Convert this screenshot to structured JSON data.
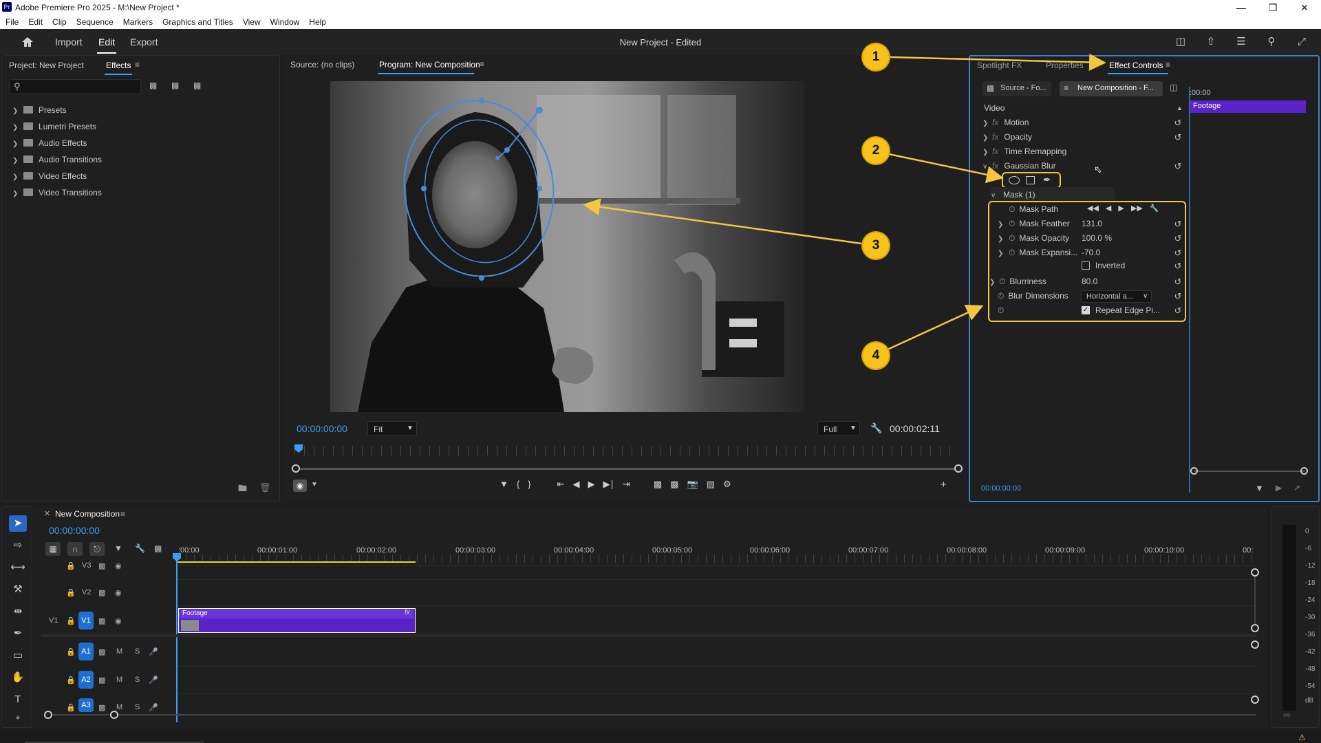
{
  "window": {
    "title": "Adobe Premiere Pro 2025 - M:\\New Project *",
    "logo_text": "Pr"
  },
  "menu": [
    "File",
    "Edit",
    "Clip",
    "Sequence",
    "Markers",
    "Graphics and Titles",
    "View",
    "Window",
    "Help"
  ],
  "header": {
    "nav": [
      "Import",
      "Edit",
      "Export"
    ],
    "active_nav": "Edit",
    "project_title": "New Project",
    "project_status": "- Edited"
  },
  "effects_panel": {
    "tab_project": "Project: New Project",
    "tab_effects": "Effects",
    "search_placeholder": "",
    "folders": [
      "Presets",
      "Lumetri Presets",
      "Audio Effects",
      "Audio Transitions",
      "Video Effects",
      "Video Transitions"
    ]
  },
  "monitor": {
    "tab_source": "Source: (no clips)",
    "tab_program": "Program: New Composition",
    "timecode_current": "00:00:00:00",
    "zoom": "Fit",
    "quality": "Full",
    "timecode_duration": "00:00:02:11"
  },
  "effect_controls": {
    "tab_spotlight": "Spotlight FX",
    "tab_properties": "Properties",
    "tab_effect_controls": "Effect Controls",
    "source_btn": "Source - Fo...",
    "comp_btn": "New Composition - F...",
    "mini_timecode": ":00:00",
    "clip_name": "Footage",
    "section_video": "Video",
    "effects": [
      "Motion",
      "Opacity",
      "Time Remapping",
      "Gaussian Blur"
    ],
    "mask_label": "Mask (1)",
    "mask_path": "Mask Path",
    "props": [
      {
        "label": "Mask Feather",
        "value": "131.0"
      },
      {
        "label": "Mask Opacity",
        "value": "100.0 %"
      },
      {
        "label": "Mask Expansi...",
        "value": "-70.0"
      }
    ],
    "inverted_label": "Inverted",
    "inverted_checked": false,
    "blurriness_label": "Blurriness",
    "blurriness_value": "80.0",
    "blur_dim_label": "Blur Dimensions",
    "blur_dim_value": "Horizontal a...",
    "repeat_edge_label": "Repeat Edge Pi...",
    "repeat_edge_checked": true,
    "footer_timecode": "00:00:00:00"
  },
  "callouts": [
    "1",
    "2",
    "3",
    "4"
  ],
  "timeline": {
    "sequence_name": "New Composition",
    "timecode": "00:00:00:00",
    "ruler": [
      ":00:00",
      "00:00:01:00",
      "00:00:02:00",
      "00:00:03:00",
      "00:00:04:00",
      "00:00:05:00",
      "00:00:06:00",
      "00:00:07:00",
      "00:00:08:00",
      "00:00:09:00",
      "00:00:10:00",
      "00:"
    ],
    "video_tracks": [
      "V3",
      "V2",
      "V1"
    ],
    "src_patch": "V1",
    "audio_tracks": [
      "A1",
      "A2",
      "A3"
    ],
    "clip_name": "Footage",
    "clip_fx": "fx",
    "mute": "M",
    "solo": "S"
  },
  "meter": {
    "labels": [
      "0",
      "-6",
      "-12",
      "-18",
      "-24",
      "-30",
      "-36",
      "-42",
      "-48",
      "-54",
      "dB"
    ]
  },
  "colors": {
    "accent_blue": "#3d9df6",
    "clip_purple": "#5a23c8",
    "callout_yellow": "#f7c21b",
    "mask_blue": "#4a8ad8"
  }
}
